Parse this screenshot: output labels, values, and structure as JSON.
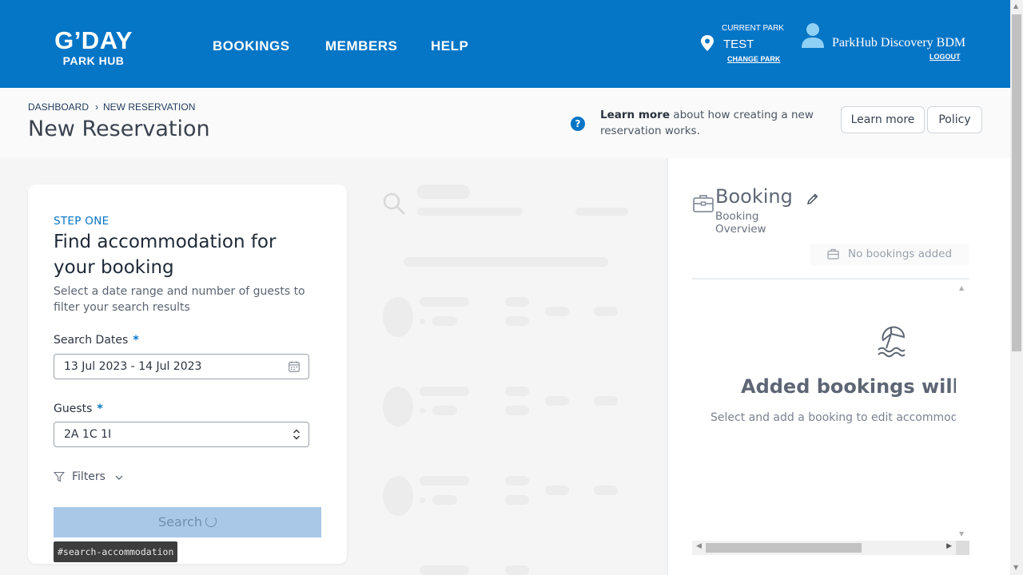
{
  "header": {
    "logo_main": "G’DAY",
    "logo_sub": "PARK HUB",
    "nav": [
      "BOOKINGS",
      "MEMBERS",
      "HELP"
    ],
    "current_park_label": "CURRENT PARK",
    "park_name": "TEST",
    "change_park": "CHANGE PARK",
    "user_name": "ParkHub Discovery BDM",
    "logout": "LOGOUT",
    "bg_color": "#0575c6"
  },
  "title_bar": {
    "breadcrumbs": [
      "DASHBOARD",
      "NEW RESERVATION"
    ],
    "breadcrumb_separator": "›",
    "title": "New Reservation",
    "help_icon": "question-circle-icon",
    "learn_more_bold": "Learn more",
    "learn_more_text": "about how creating a new reservation works.",
    "learn_more_button": "Learn more",
    "policy_button": "Policy"
  },
  "search_card": {
    "step": "STEP ONE",
    "title": "Find accommodation for your booking",
    "description": "Select a date range and number of guests to filter your search results",
    "dates_label": "Search Dates",
    "dates_value": "13 Jul 2023 - 14 Jul 2023",
    "guests_label": "Guests",
    "guests_value": "2A 1C 1I",
    "required_mark": "*",
    "filters_label": "Filters",
    "search_button": "Search",
    "tooltip": "#search-accommodation"
  },
  "booking_panel": {
    "title": "Booking",
    "subtitle": "Booking Overview",
    "no_bookings": "No bookings added",
    "empty_title": "Added bookings will ap",
    "empty_subtitle": "Select and add a booking to edit accommoda"
  },
  "colors": {
    "accent": "#0575c6",
    "search_button_disabled": "#a9c8e8"
  }
}
